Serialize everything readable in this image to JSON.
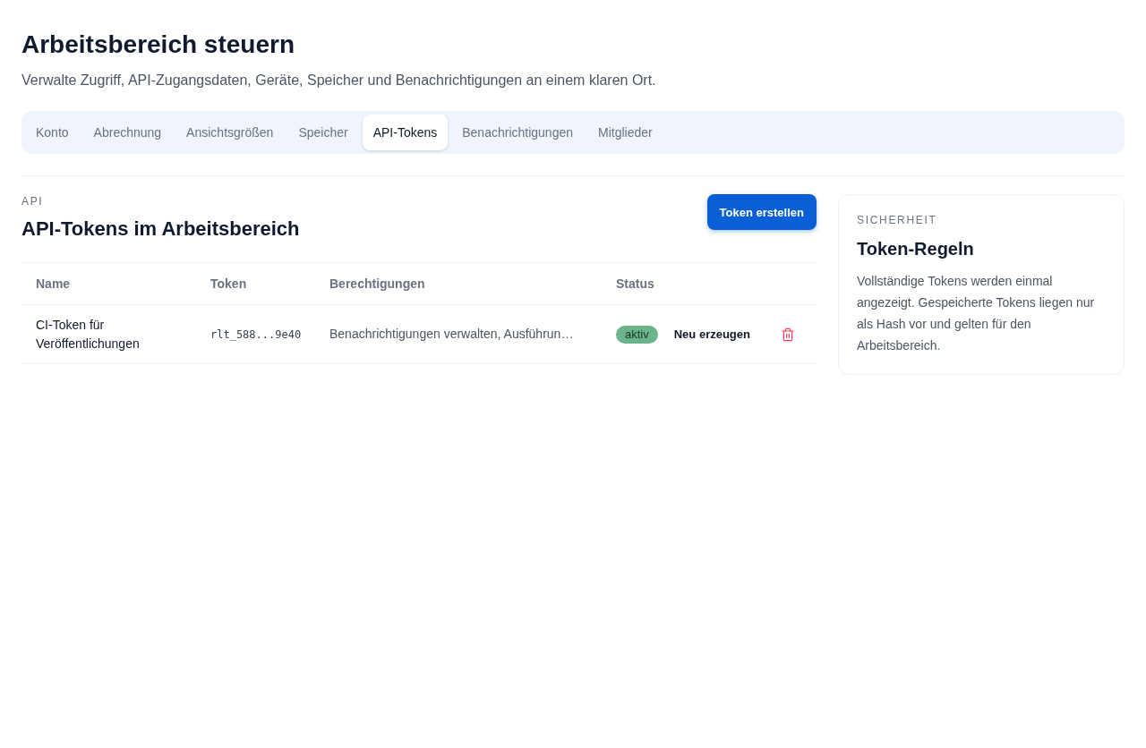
{
  "page": {
    "title": "Arbeitsbereich steuern",
    "subtitle": "Verwalte Zugriff, API-Zugangsdaten, Geräte, Speicher und Benachrichtigungen an einem klaren Ort."
  },
  "tabs": [
    {
      "label": "Konto",
      "selected": false
    },
    {
      "label": "Abrechnung",
      "selected": false
    },
    {
      "label": "Ansichtsgrößen",
      "selected": false
    },
    {
      "label": "Speicher",
      "selected": false
    },
    {
      "label": "API-Tokens",
      "selected": true
    },
    {
      "label": "Benachrichtigungen",
      "selected": false
    },
    {
      "label": "Mitglieder",
      "selected": false
    }
  ],
  "section": {
    "eyebrow": "API",
    "title": "API-Tokens im Arbeitsbereich",
    "primary_button": "Token erstellen"
  },
  "table": {
    "columns": [
      "Name",
      "Token",
      "Berechtigungen",
      "Status"
    ],
    "rows": [
      {
        "name": "CI-Token für Veröffentlichungen",
        "token": "rlt_588...9e40",
        "permissions": "Benachrichtigungen verwalten, Ausführun…",
        "status": {
          "label": "aktiv",
          "kind": "active"
        },
        "actions": [
          {
            "kind": "text",
            "label": "Neu erzeugen"
          },
          {
            "kind": "delete"
          }
        ]
      }
    ]
  },
  "aside": {
    "eyebrow": "SICHERHEIT",
    "title": "Token-Regeln",
    "text": "Vollständige Tokens werden einmal angezeigt. Gespeicherte Tokens liegen nur als Hash vor und gelten für den Arbeitsbereich."
  }
}
